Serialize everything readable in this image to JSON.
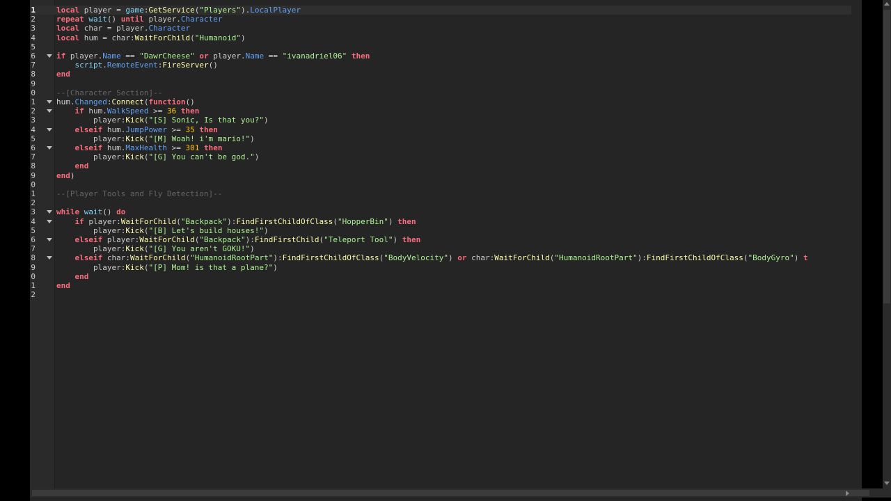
{
  "editor": {
    "current_line": 1,
    "lines": [
      {
        "n": "1",
        "fold": false,
        "tokens": [
          [
            "kw",
            "local"
          ],
          [
            "plain",
            " player = "
          ],
          [
            "builtin",
            "game"
          ],
          [
            "plain",
            ":"
          ],
          [
            "method",
            "GetService"
          ],
          [
            "plain",
            "("
          ],
          [
            "str",
            "\"Players\""
          ],
          [
            "plain",
            ")."
          ],
          [
            "prop",
            "LocalPlayer"
          ]
        ]
      },
      {
        "n": "2",
        "fold": false,
        "tokens": [
          [
            "kw",
            "repeat"
          ],
          [
            "plain",
            " "
          ],
          [
            "builtin",
            "wait"
          ],
          [
            "plain",
            "() "
          ],
          [
            "kw",
            "until"
          ],
          [
            "plain",
            " player."
          ],
          [
            "prop",
            "Character"
          ]
        ]
      },
      {
        "n": "3",
        "fold": false,
        "tokens": [
          [
            "kw",
            "local"
          ],
          [
            "plain",
            " char = player."
          ],
          [
            "prop",
            "Character"
          ]
        ]
      },
      {
        "n": "4",
        "fold": false,
        "tokens": [
          [
            "kw",
            "local"
          ],
          [
            "plain",
            " hum = char:"
          ],
          [
            "method",
            "WaitForChild"
          ],
          [
            "plain",
            "("
          ],
          [
            "str",
            "\"Humanoid\""
          ],
          [
            "plain",
            ")"
          ]
        ]
      },
      {
        "n": "5",
        "fold": false,
        "tokens": []
      },
      {
        "n": "6",
        "fold": true,
        "tokens": [
          [
            "kw",
            "if"
          ],
          [
            "plain",
            " player."
          ],
          [
            "prop",
            "Name"
          ],
          [
            "plain",
            " == "
          ],
          [
            "str",
            "\"DawrCheese\""
          ],
          [
            "plain",
            " "
          ],
          [
            "kw",
            "or"
          ],
          [
            "plain",
            " player."
          ],
          [
            "prop",
            "Name"
          ],
          [
            "plain",
            " == "
          ],
          [
            "str",
            "\"ivanadriel06\""
          ],
          [
            "plain",
            " "
          ],
          [
            "kw",
            "then"
          ]
        ]
      },
      {
        "n": "7",
        "fold": false,
        "tokens": [
          [
            "plain",
            "    "
          ],
          [
            "builtin",
            "script"
          ],
          [
            "plain",
            "."
          ],
          [
            "prop",
            "RemoteEvent"
          ],
          [
            "plain",
            ":"
          ],
          [
            "method",
            "FireServer"
          ],
          [
            "plain",
            "()"
          ]
        ]
      },
      {
        "n": "8",
        "fold": false,
        "tokens": [
          [
            "kw",
            "end"
          ]
        ]
      },
      {
        "n": "9",
        "fold": false,
        "tokens": []
      },
      {
        "n": "0",
        "fold": false,
        "tokens": [
          [
            "cmt",
            "--[Character Section]--"
          ]
        ]
      },
      {
        "n": "1",
        "fold": true,
        "tokens": [
          [
            "plain",
            "hum."
          ],
          [
            "prop",
            "Changed"
          ],
          [
            "plain",
            ":"
          ],
          [
            "method",
            "Connect"
          ],
          [
            "plain",
            "("
          ],
          [
            "kw",
            "function"
          ],
          [
            "plain",
            "()"
          ]
        ]
      },
      {
        "n": "2",
        "fold": true,
        "tokens": [
          [
            "plain",
            "    "
          ],
          [
            "kw",
            "if"
          ],
          [
            "plain",
            " hum."
          ],
          [
            "prop",
            "WalkSpeed"
          ],
          [
            "plain",
            " >= "
          ],
          [
            "num",
            "36"
          ],
          [
            "plain",
            " "
          ],
          [
            "kw",
            "then"
          ]
        ]
      },
      {
        "n": "3",
        "fold": false,
        "tokens": [
          [
            "plain",
            "        player:"
          ],
          [
            "method",
            "Kick"
          ],
          [
            "plain",
            "("
          ],
          [
            "str",
            "\"[S] Sonic, Is that you?\""
          ],
          [
            "plain",
            ")"
          ]
        ]
      },
      {
        "n": "4",
        "fold": true,
        "tokens": [
          [
            "plain",
            "    "
          ],
          [
            "kw",
            "elseif"
          ],
          [
            "plain",
            " hum."
          ],
          [
            "prop",
            "JumpPower"
          ],
          [
            "plain",
            " >= "
          ],
          [
            "num",
            "35"
          ],
          [
            "plain",
            " "
          ],
          [
            "kw",
            "then"
          ]
        ]
      },
      {
        "n": "5",
        "fold": false,
        "tokens": [
          [
            "plain",
            "        player:"
          ],
          [
            "method",
            "Kick"
          ],
          [
            "plain",
            "("
          ],
          [
            "str",
            "\"[M] Woah! i'm mario!\""
          ],
          [
            "plain",
            ")"
          ]
        ]
      },
      {
        "n": "6",
        "fold": true,
        "tokens": [
          [
            "plain",
            "    "
          ],
          [
            "kw",
            "elseif"
          ],
          [
            "plain",
            " hum."
          ],
          [
            "prop",
            "MaxHealth"
          ],
          [
            "plain",
            " >= "
          ],
          [
            "num",
            "301"
          ],
          [
            "plain",
            " "
          ],
          [
            "kw",
            "then"
          ]
        ]
      },
      {
        "n": "7",
        "fold": false,
        "tokens": [
          [
            "plain",
            "        player:"
          ],
          [
            "method",
            "Kick"
          ],
          [
            "plain",
            "("
          ],
          [
            "str",
            "\"[G] You can't be god.\""
          ],
          [
            "plain",
            ")"
          ]
        ]
      },
      {
        "n": "8",
        "fold": false,
        "tokens": [
          [
            "plain",
            "    "
          ],
          [
            "kw",
            "end"
          ]
        ]
      },
      {
        "n": "9",
        "fold": false,
        "tokens": [
          [
            "kw",
            "end"
          ],
          [
            "plain",
            ")"
          ]
        ]
      },
      {
        "n": "0",
        "fold": false,
        "tokens": []
      },
      {
        "n": "1",
        "fold": false,
        "tokens": [
          [
            "cmt",
            "--[Player Tools and Fly Detection]--"
          ]
        ]
      },
      {
        "n": "2",
        "fold": false,
        "tokens": []
      },
      {
        "n": "3",
        "fold": true,
        "tokens": [
          [
            "kw",
            "while"
          ],
          [
            "plain",
            " "
          ],
          [
            "builtin",
            "wait"
          ],
          [
            "plain",
            "() "
          ],
          [
            "kw",
            "do"
          ]
        ]
      },
      {
        "n": "4",
        "fold": true,
        "tokens": [
          [
            "plain",
            "    "
          ],
          [
            "kw",
            "if"
          ],
          [
            "plain",
            " player:"
          ],
          [
            "method",
            "WaitForChild"
          ],
          [
            "plain",
            "("
          ],
          [
            "str",
            "\"Backpack\""
          ],
          [
            "plain",
            "):"
          ],
          [
            "method",
            "FindFirstChildOfClass"
          ],
          [
            "plain",
            "("
          ],
          [
            "str",
            "\"HopperBin\""
          ],
          [
            "plain",
            ") "
          ],
          [
            "kw",
            "then"
          ]
        ]
      },
      {
        "n": "5",
        "fold": false,
        "tokens": [
          [
            "plain",
            "        player:"
          ],
          [
            "method",
            "Kick"
          ],
          [
            "plain",
            "("
          ],
          [
            "str",
            "\"[B] Let's build houses!\""
          ],
          [
            "plain",
            ")"
          ]
        ]
      },
      {
        "n": "6",
        "fold": true,
        "tokens": [
          [
            "plain",
            "    "
          ],
          [
            "kw",
            "elseif"
          ],
          [
            "plain",
            " player:"
          ],
          [
            "method",
            "WaitForChild"
          ],
          [
            "plain",
            "("
          ],
          [
            "str",
            "\"Backpack\""
          ],
          [
            "plain",
            "):"
          ],
          [
            "method",
            "FindFirstChild"
          ],
          [
            "plain",
            "("
          ],
          [
            "str",
            "\"Teleport Tool\""
          ],
          [
            "plain",
            ") "
          ],
          [
            "kw",
            "then"
          ]
        ]
      },
      {
        "n": "7",
        "fold": false,
        "tokens": [
          [
            "plain",
            "        player:"
          ],
          [
            "method",
            "Kick"
          ],
          [
            "plain",
            "("
          ],
          [
            "str",
            "\"[G] You aren't GOKU!\""
          ],
          [
            "plain",
            ")"
          ]
        ]
      },
      {
        "n": "8",
        "fold": true,
        "tokens": [
          [
            "plain",
            "    "
          ],
          [
            "kw",
            "elseif"
          ],
          [
            "plain",
            " char:"
          ],
          [
            "method",
            "WaitForChild"
          ],
          [
            "plain",
            "("
          ],
          [
            "str",
            "\"HumanoidRootPart\""
          ],
          [
            "plain",
            "):"
          ],
          [
            "method",
            "FindFirstChildOfClass"
          ],
          [
            "plain",
            "("
          ],
          [
            "str",
            "\"BodyVelocity\""
          ],
          [
            "plain",
            ") "
          ],
          [
            "kw",
            "or"
          ],
          [
            "plain",
            " char:"
          ],
          [
            "method",
            "WaitForChild"
          ],
          [
            "plain",
            "("
          ],
          [
            "str",
            "\"HumanoidRootPart\""
          ],
          [
            "plain",
            "):"
          ],
          [
            "method",
            "FindFirstChildOfClass"
          ],
          [
            "plain",
            "("
          ],
          [
            "str",
            "\"BodyGyro\""
          ],
          [
            "plain",
            ") "
          ],
          [
            "kw",
            "t"
          ]
        ]
      },
      {
        "n": "9",
        "fold": false,
        "tokens": [
          [
            "plain",
            "        player:"
          ],
          [
            "method",
            "Kick"
          ],
          [
            "plain",
            "("
          ],
          [
            "str",
            "\"[P] Mom! is that a plane?\""
          ],
          [
            "plain",
            ")"
          ]
        ]
      },
      {
        "n": "0",
        "fold": false,
        "tokens": [
          [
            "plain",
            "    "
          ],
          [
            "kw",
            "end"
          ]
        ]
      },
      {
        "n": "1",
        "fold": false,
        "tokens": [
          [
            "kw",
            "end"
          ]
        ]
      },
      {
        "n": "2",
        "fold": false,
        "tokens": []
      }
    ]
  },
  "colors": {
    "background": "#252525",
    "keyword": "#f86d7c",
    "string": "#adf195",
    "number": "#ffc600",
    "builtin": "#84d6f7",
    "property": "#61a1f1",
    "method": "#fdfbac",
    "comment": "#666666",
    "text": "#cccccc"
  }
}
